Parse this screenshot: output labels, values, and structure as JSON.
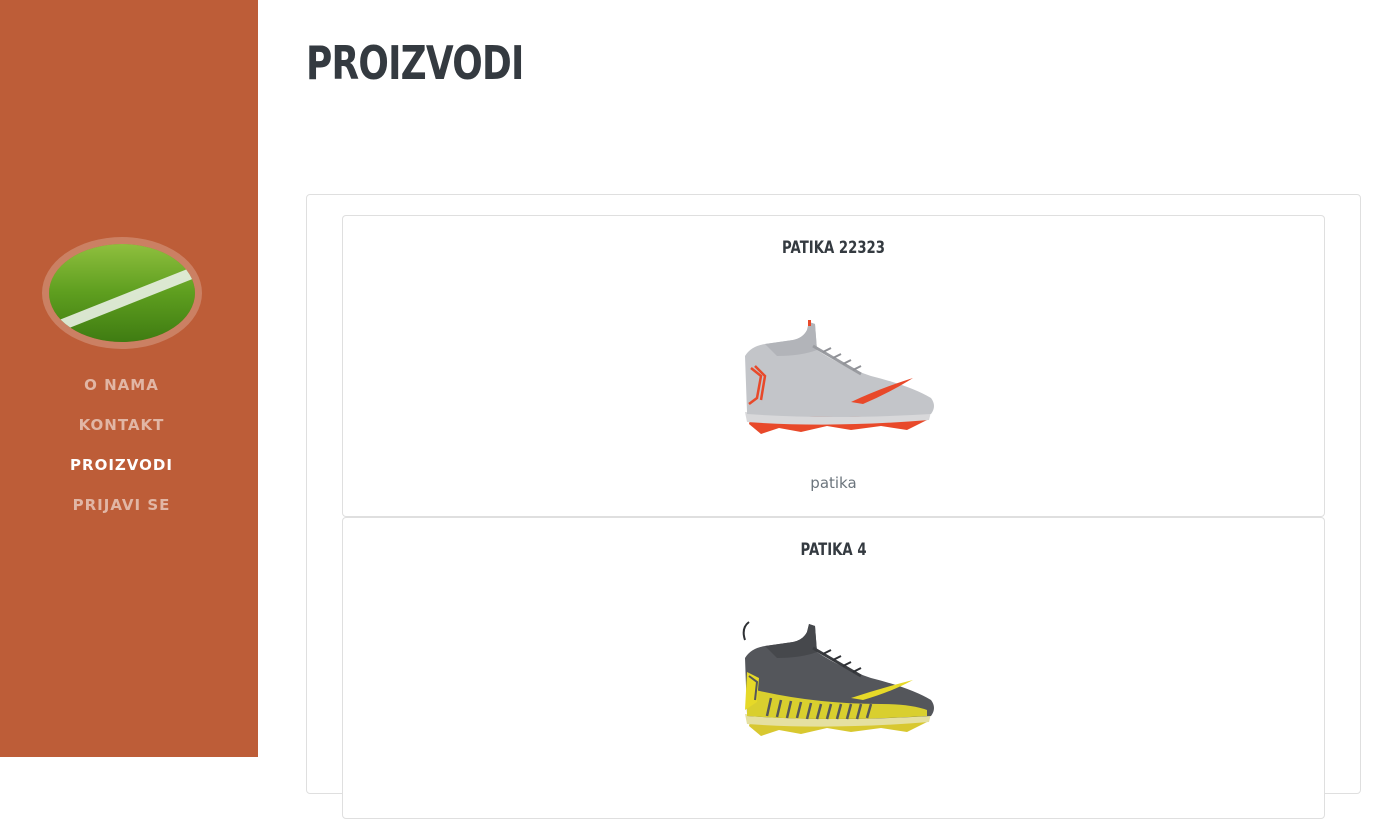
{
  "sidebar": {
    "colors": {
      "background": "#bd5d38"
    },
    "nav": [
      {
        "label": "O NAMA",
        "active": false
      },
      {
        "label": "KONTAKT",
        "active": false
      },
      {
        "label": "PROIZVODI",
        "active": true
      },
      {
        "label": "PRIJAVI SE",
        "active": false
      }
    ]
  },
  "main": {
    "title": "PROIZVODI",
    "products": [
      {
        "name": "PATIKA 22323",
        "description": "patika",
        "image_icon": "cleat-silver-red"
      },
      {
        "name": "PATIKA 4",
        "description": "",
        "image_icon": "cleat-grey-yellow"
      }
    ]
  }
}
